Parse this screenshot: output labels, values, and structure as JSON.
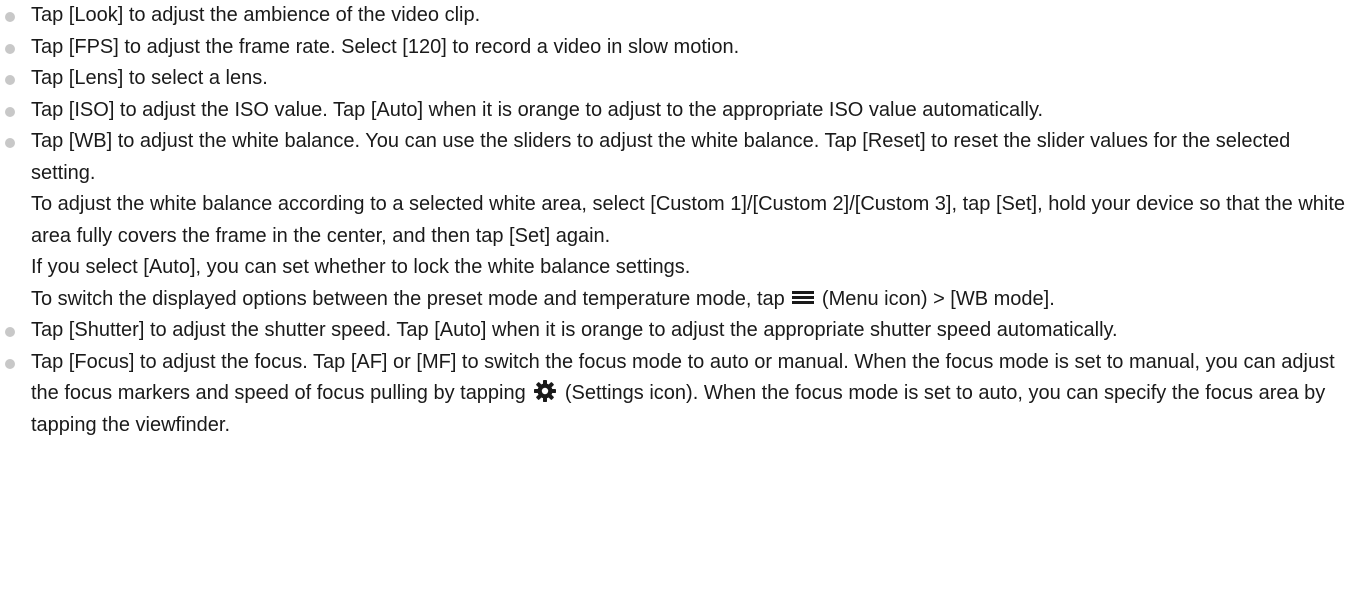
{
  "items": [
    {
      "text": "Tap [Look] to adjust the ambience of the video clip."
    },
    {
      "text": "Tap [FPS] to adjust the frame rate. Select [120] to record a video in slow motion."
    },
    {
      "text": "Tap [Lens] to select a lens."
    },
    {
      "text": "Tap [ISO] to adjust the ISO value. Tap [Auto] when it is orange to adjust to the appropriate ISO value automatically."
    },
    {
      "text": "Tap [WB] to adjust the white balance. You can use the sliders to adjust the white balance. Tap [Reset] to reset the slider values for the selected setting.",
      "p2": "To adjust the white balance according to a selected white area, select [Custom 1]/[Custom 2]/[Custom 3], tap [Set], hold your device so that the white area fully covers the frame in the center, and then tap [Set] again.",
      "p3": "If you select [Auto], you can set whether to lock the white balance settings.",
      "p4_before": "To switch the displayed options between the preset mode and temperature mode, tap",
      "p4_after": "(Menu icon) > [WB mode]."
    },
    {
      "text": "Tap [Shutter] to adjust the shutter speed. Tap [Auto] when it is orange to adjust the appropriate shutter speed automatically."
    },
    {
      "text_before": "Tap [Focus] to adjust the focus. Tap [AF] or [MF] to switch the focus mode to auto or manual. When the focus mode is set to manual, you can adjust the focus markers and speed of focus pulling by tapping",
      "text_after": "(Settings icon). When the focus mode is set to auto, you can specify the focus area by tapping the viewfinder."
    }
  ],
  "icons": {
    "menu": "menu-icon",
    "settings": "gear-icon"
  },
  "colors": {
    "text": "#1a1a1a",
    "bullet": "#c8c8c8"
  }
}
